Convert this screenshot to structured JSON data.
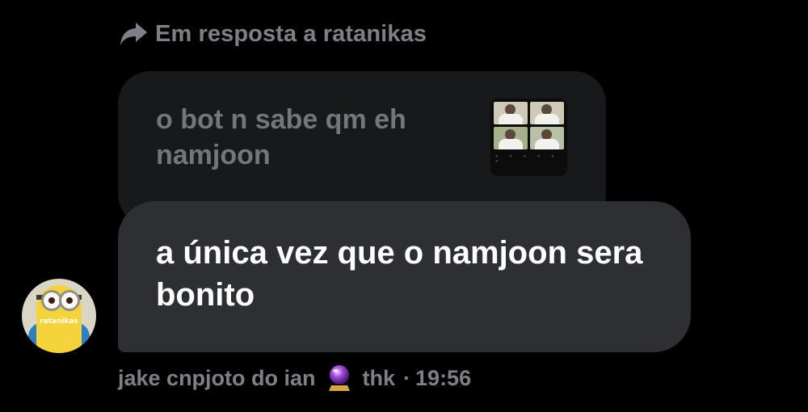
{
  "reply_header": {
    "icon": "reply-arrow-icon",
    "text": "Em resposta a ratanikas"
  },
  "quoted_message": {
    "text": "o bot n sabe qm eh namjoon",
    "thumbnail": {
      "icon": "image-thumbnail",
      "caption": "ratanikas"
    }
  },
  "message": {
    "text": "a única vez que o namjoon sera bonito"
  },
  "avatar": {
    "label": "ratanikas"
  },
  "meta": {
    "sender": "jake cnpjoto do ian",
    "emoji_icon": "crystal-ball-icon",
    "sender_suffix": "thk",
    "separator": "·",
    "time": "19:56"
  },
  "colors": {
    "background": "#000000",
    "quoted_bubble": "#18191b",
    "message_bubble": "#2e2f33",
    "muted_text": "#7d8085",
    "message_text": "#ffffff"
  }
}
